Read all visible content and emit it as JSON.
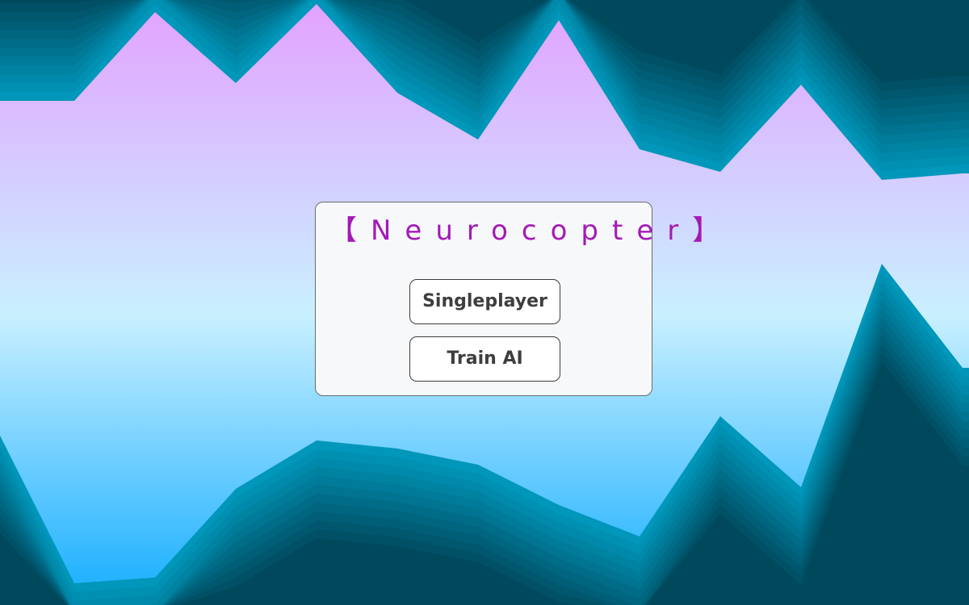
{
  "game": {
    "title": "【Neurocopter】",
    "title_color": "#a31ab6"
  },
  "menu": {
    "buttons": [
      {
        "label": "Singleplayer"
      },
      {
        "label": "Train AI"
      }
    ]
  },
  "colors": {
    "sky_top": "#e3a1ff",
    "sky_mid": "#c9f0ff",
    "sky_bottom": "#14adff",
    "terrain_light": "#0097bb",
    "terrain_dark": "#00495d"
  }
}
